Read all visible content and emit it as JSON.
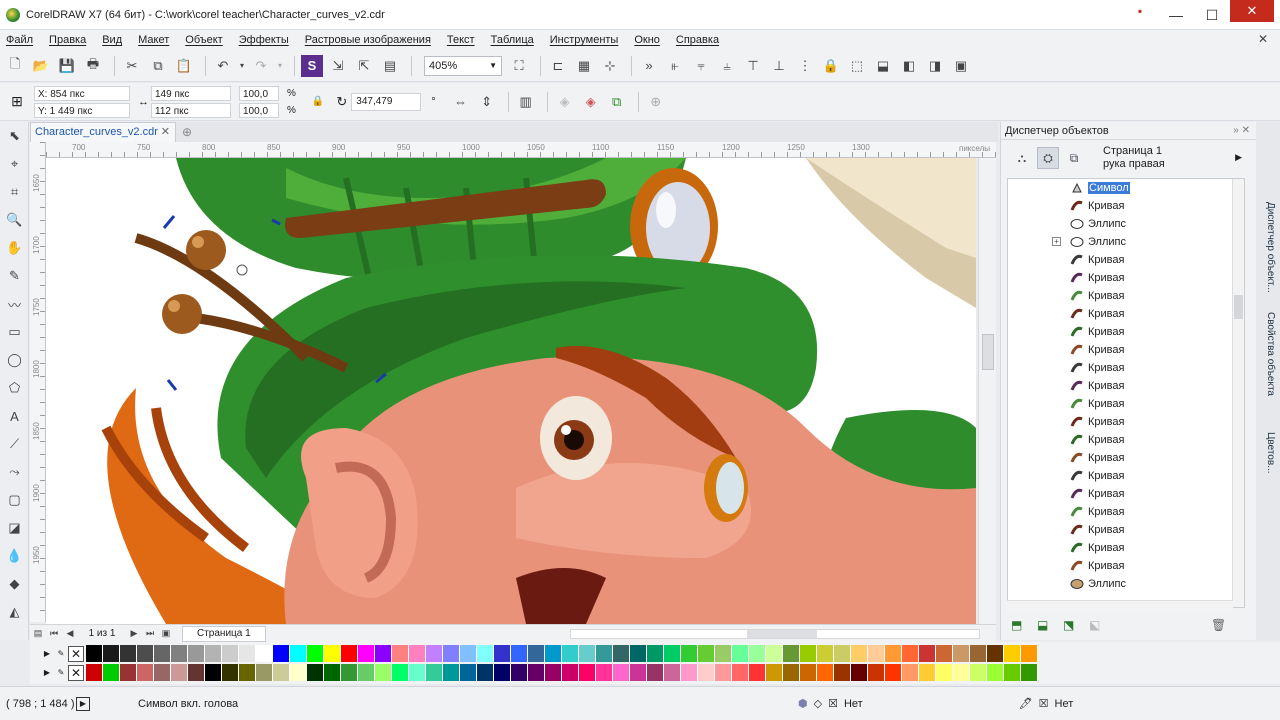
{
  "window": {
    "title": "CorelDRAW X7 (64 бит) - C:\\work\\corel teacher\\Character_curves_v2.cdr"
  },
  "menu": [
    "Файл",
    "Правка",
    "Вид",
    "Макет",
    "Объект",
    "Эффекты",
    "Растровые изображения",
    "Текст",
    "Таблица",
    "Инструменты",
    "Окно",
    "Справка"
  ],
  "toolbar": {
    "zoom": "405%"
  },
  "property_bar": {
    "x": "X: 854 пкс",
    "y": "Y: 1 449 пкс",
    "w": "149 пкс",
    "h": "112 пкс",
    "scale_x": "100,0",
    "scale_y": "100,0",
    "pct": "%",
    "angle": "347,479",
    "angle_unit": "°"
  },
  "document": {
    "tab": "Character_curves_v2.cdr"
  },
  "ruler": {
    "top": [
      "700",
      "750",
      "800",
      "850",
      "900",
      "950",
      "1000",
      "1050",
      "1100",
      "1150",
      "1200",
      "1250",
      "1300"
    ],
    "unit": "пикселы",
    "left": [
      "1650",
      "1700",
      "1750",
      "1800",
      "1850",
      "1900",
      "1950"
    ]
  },
  "page_nav": {
    "count": "1 из 1",
    "page": "Страница 1"
  },
  "object_manager": {
    "title": "Диспетчер объектов",
    "page": "Страница 1",
    "layer": "рука правая",
    "items": [
      {
        "label": "Символ",
        "type": "symbol",
        "selected": true
      },
      {
        "label": "Кривая",
        "type": "curve"
      },
      {
        "label": "Эллипс",
        "type": "ellipse"
      },
      {
        "label": "Эллипс",
        "type": "ellipse",
        "expand": "+"
      },
      {
        "label": "Кривая",
        "type": "curve"
      },
      {
        "label": "Кривая",
        "type": "curve"
      },
      {
        "label": "Кривая",
        "type": "curve"
      },
      {
        "label": "Кривая",
        "type": "curve"
      },
      {
        "label": "Кривая",
        "type": "curve"
      },
      {
        "label": "Кривая",
        "type": "curve"
      },
      {
        "label": "Кривая",
        "type": "curve"
      },
      {
        "label": "Кривая",
        "type": "curve"
      },
      {
        "label": "Кривая",
        "type": "curve"
      },
      {
        "label": "Кривая",
        "type": "curve"
      },
      {
        "label": "Кривая",
        "type": "curve"
      },
      {
        "label": "Кривая",
        "type": "curve"
      },
      {
        "label": "Кривая",
        "type": "curve"
      },
      {
        "label": "Кривая",
        "type": "curve"
      },
      {
        "label": "Кривая",
        "type": "curve"
      },
      {
        "label": "Кривая",
        "type": "curve"
      },
      {
        "label": "Кривая",
        "type": "curve"
      },
      {
        "label": "Кривая",
        "type": "curve"
      },
      {
        "label": "Эллипс",
        "type": "ellipse"
      }
    ]
  },
  "docker_tabs": [
    "Диспетчер объект...",
    "Свойства объекта",
    "Цветов..."
  ],
  "palette": {
    "row1": [
      "#000000",
      "#1a1a1a",
      "#333333",
      "#4d4d4d",
      "#666666",
      "#808080",
      "#999999",
      "#b3b3b3",
      "#cccccc",
      "#e6e6e6",
      "#ffffff",
      "#0000ff",
      "#00ffff",
      "#00ff00",
      "#ffff00",
      "#ff0000",
      "#ff00ff",
      "#8b00ff",
      "#ff8080",
      "#ff80c0",
      "#c080ff",
      "#8080ff",
      "#80c0ff",
      "#80ffff",
      "#3333cc",
      "#3366ff",
      "#336699",
      "#0099cc",
      "#33cccc",
      "#66cccc",
      "#339999",
      "#336666",
      "#006666",
      "#009966",
      "#00cc66",
      "#33cc33",
      "#66cc33",
      "#99cc66",
      "#66ff99",
      "#99ff99",
      "#ccff99",
      "#669933",
      "#99cc00",
      "#cccc33",
      "#cccc66",
      "#ffcc66",
      "#ffcc99",
      "#ff9933",
      "#ff6633",
      "#cc3333",
      "#cc6633",
      "#cc9966",
      "#996633",
      "#663300",
      "#ffcc00",
      "#ff9900"
    ],
    "row2": [
      "#cc0000",
      "#00cc00",
      "#993333",
      "#cc6666",
      "#996666",
      "#cc9999",
      "#663333",
      "#000000",
      "#333300",
      "#666600",
      "#999966",
      "#cccc99",
      "#ffffcc",
      "#003300",
      "#006600",
      "#339933",
      "#66cc66",
      "#99ff66",
      "#00ff66",
      "#66ffcc",
      "#33cc99",
      "#009999",
      "#006699",
      "#003366",
      "#000066",
      "#330066",
      "#660066",
      "#990066",
      "#cc0066",
      "#ff0066",
      "#ff3399",
      "#ff66cc",
      "#cc3399",
      "#993366",
      "#cc6699",
      "#ff99cc",
      "#ffcccc",
      "#ff9999",
      "#ff6666",
      "#ff3333",
      "#cc9900",
      "#996600",
      "#cc6600",
      "#ff6600",
      "#993300",
      "#660000",
      "#cc3300",
      "#ff3300",
      "#ff9966",
      "#ffcc33",
      "#ffff66",
      "#ffff99",
      "#ccff66",
      "#99ff33",
      "#66cc00",
      "#339900"
    ]
  },
  "status": {
    "coords": "( 798 ; 1 484 )",
    "text": "Символ вкл. голова",
    "fill": "Нет",
    "stroke": "Нет"
  }
}
